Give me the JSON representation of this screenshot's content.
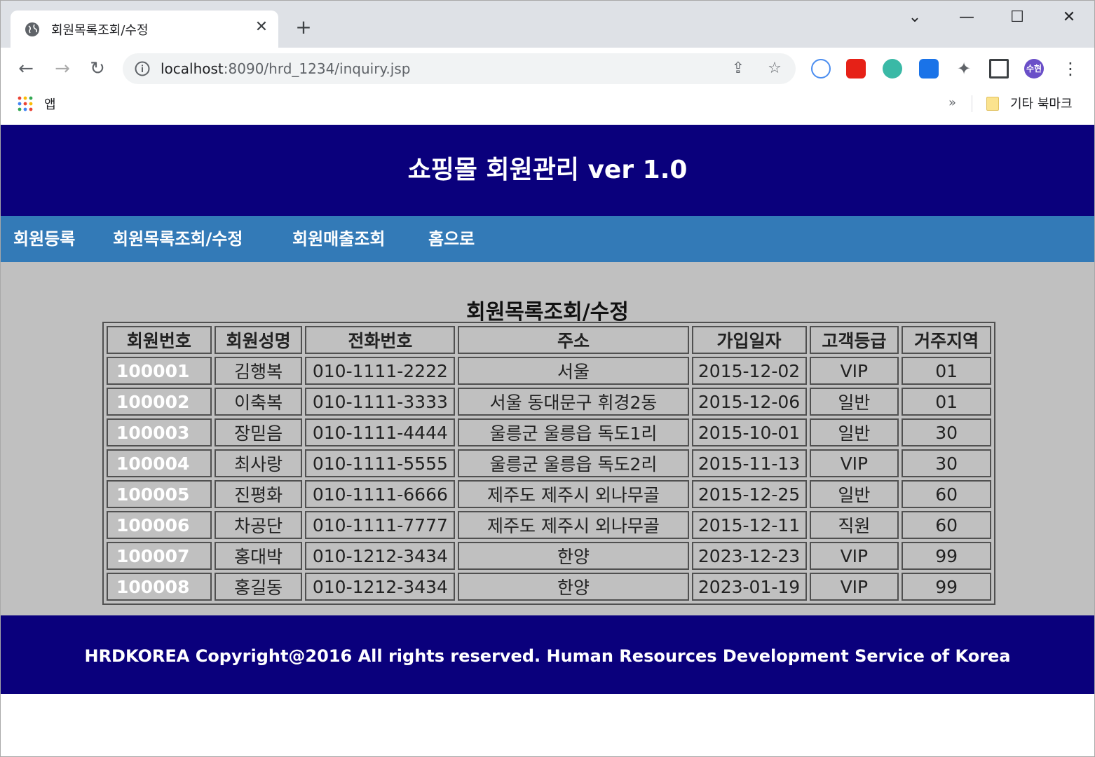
{
  "browser": {
    "tab_title": "회원목록조회/수정",
    "tab_close": "✕",
    "new_tab": "+",
    "url_host": "localhost",
    "url_path": ":8090/hrd_1234/inquiry.jsp",
    "profile_label": "수현",
    "bookmarks": {
      "apps_label": "앱",
      "more": "»",
      "other_label": "기타 북마크"
    }
  },
  "page": {
    "title": "쇼핑몰 회원관리 ver 1.0",
    "nav": [
      "회원등록",
      "회원목록조회/수정",
      "회원매출조회",
      "홈으로"
    ],
    "section_title": "회원목록조회/수정",
    "table": {
      "headers": [
        "회원번호",
        "회원성명",
        "전화번호",
        "주소",
        "가입일자",
        "고객등급",
        "거주지역"
      ],
      "rows": [
        [
          "100001",
          "김행복",
          "010-1111-2222",
          "서울",
          "2015-12-02",
          "VIP",
          "01"
        ],
        [
          "100002",
          "이축복",
          "010-1111-3333",
          "서울 동대문구 휘경2동",
          "2015-12-06",
          "일반",
          "01"
        ],
        [
          "100003",
          "장믿음",
          "010-1111-4444",
          "울릉군 울릉읍 독도1리",
          "2015-10-01",
          "일반",
          "30"
        ],
        [
          "100004",
          "최사랑",
          "010-1111-5555",
          "울릉군 울릉읍 독도2리",
          "2015-11-13",
          "VIP",
          "30"
        ],
        [
          "100005",
          "진평화",
          "010-1111-6666",
          "제주도 제주시 외나무골",
          "2015-12-25",
          "일반",
          "60"
        ],
        [
          "100006",
          "차공단",
          "010-1111-7777",
          "제주도 제주시 외나무골",
          "2015-12-11",
          "직원",
          "60"
        ],
        [
          "100007",
          "홍대박",
          "010-1212-3434",
          "한양",
          "2023-12-23",
          "VIP",
          "99"
        ],
        [
          "100008",
          "홍길동",
          "010-1212-3434",
          "한양",
          "2023-01-19",
          "VIP",
          "99"
        ]
      ]
    },
    "footer": "HRDKOREA Copyright@2016 All rights reserved. Human Resources Development Service of Korea"
  },
  "colors": {
    "header_bg": "#0a007c",
    "nav_bg": "#337ab7",
    "section_bg": "#c0c0c0"
  }
}
